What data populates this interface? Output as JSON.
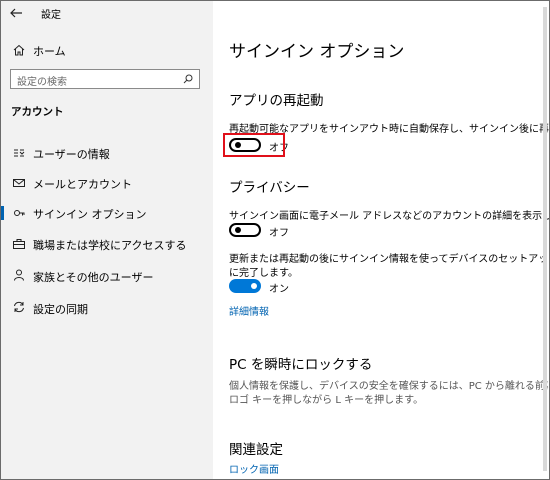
{
  "window": {
    "title": "設定",
    "minimize_glyph": "—",
    "maximize_glyph": "☐",
    "close_glyph": "✕"
  },
  "sidebar": {
    "home_label": "ホーム",
    "search_placeholder": "設定の検索",
    "section_title": "アカウント",
    "items": [
      {
        "label": "ユーザーの情報",
        "icon": "user-info-icon"
      },
      {
        "label": "メールとアカウント",
        "icon": "mail-icon"
      },
      {
        "label": "サインイン オプション",
        "icon": "key-icon",
        "selected": true
      },
      {
        "label": "職場または学校にアクセスする",
        "icon": "briefcase-icon"
      },
      {
        "label": "家族とその他のユーザー",
        "icon": "person-icon"
      },
      {
        "label": "設定の同期",
        "icon": "sync-icon"
      }
    ]
  },
  "main": {
    "page_title": "サインイン オプション",
    "restart": {
      "heading": "アプリの再起動",
      "description": "再起動可能なアプリをサインアウト時に自動保存し、サインイン後に再起動する。",
      "toggle_state": "オフ"
    },
    "privacy": {
      "heading": "プライバシー",
      "description1": "サインイン画面に電子メール アドレスなどのアカウントの詳細を表示します。",
      "toggle1_state": "オフ",
      "description2_line1": "更新または再起動の後にサインイン情報を使ってデバイスのセットアップを自動的",
      "description2_line2": "に完了します。",
      "toggle2_state": "オン",
      "more_info_link": "詳細情報"
    },
    "lock": {
      "heading": "PC を瞬時にロックする",
      "description_line1": "個人情報を保護し、デバイスの安全を確保するには、PC から離れる前に、Windows",
      "description_line2": "ロゴ キーを押しながら L キーを押します。"
    },
    "related": {
      "heading": "関連設定",
      "lock_screen_link": "ロック画面"
    }
  },
  "colors": {
    "accent": "#0078d7",
    "link": "#0063b1",
    "highlight_box": "#e0101a",
    "sidebar_bg": "#f2f2f2"
  }
}
